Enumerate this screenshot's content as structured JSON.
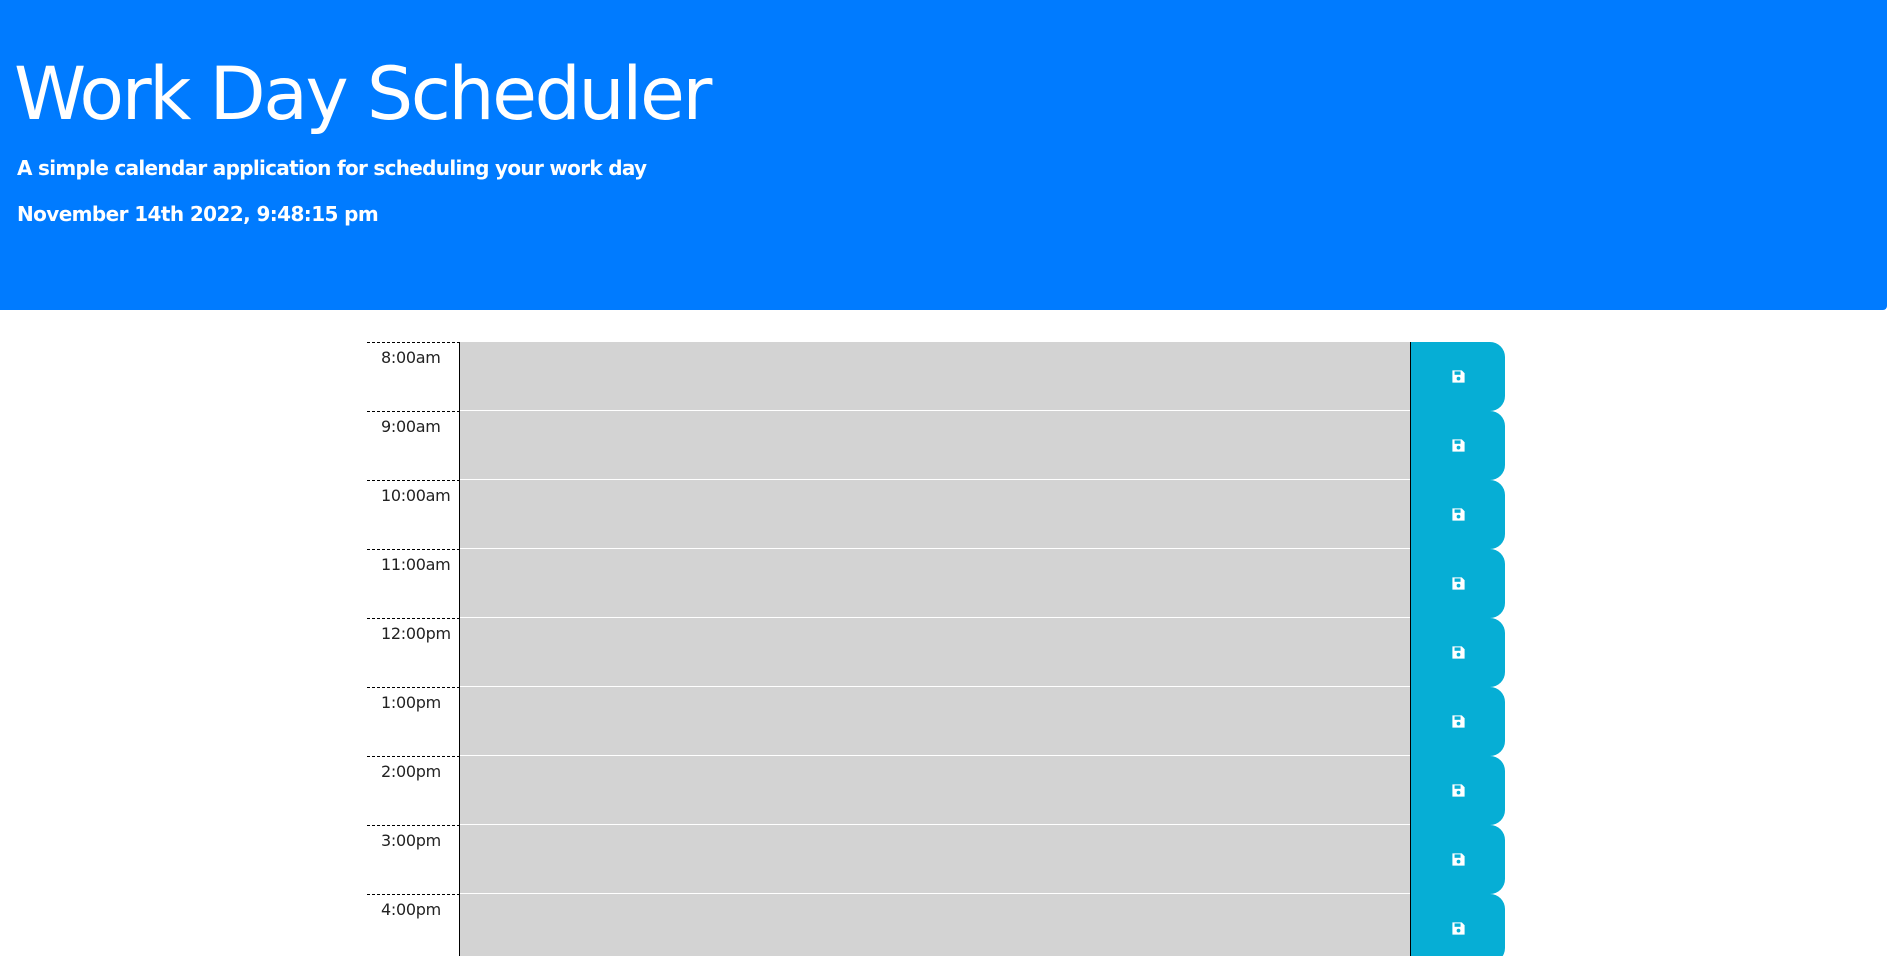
{
  "header": {
    "title": "Work Day Scheduler",
    "subtitle": "A simple calendar application for scheduling your work day",
    "current_datetime": "November 14th 2022, 9:48:15 pm"
  },
  "time_blocks": [
    {
      "hour": "8:00am",
      "description": "",
      "status": "past"
    },
    {
      "hour": "9:00am",
      "description": "",
      "status": "past"
    },
    {
      "hour": "10:00am",
      "description": "",
      "status": "past"
    },
    {
      "hour": "11:00am",
      "description": "",
      "status": "past"
    },
    {
      "hour": "12:00pm",
      "description": "",
      "status": "past"
    },
    {
      "hour": "1:00pm",
      "description": "",
      "status": "past"
    },
    {
      "hour": "2:00pm",
      "description": "",
      "status": "past"
    },
    {
      "hour": "3:00pm",
      "description": "",
      "status": "past"
    },
    {
      "hour": "4:00pm",
      "description": "",
      "status": "past"
    }
  ],
  "save_button": {
    "icon": "save-icon"
  },
  "colors": {
    "header_background": "#007bff",
    "past_block": "#d3d3d3",
    "save_button": "#06aed5"
  }
}
